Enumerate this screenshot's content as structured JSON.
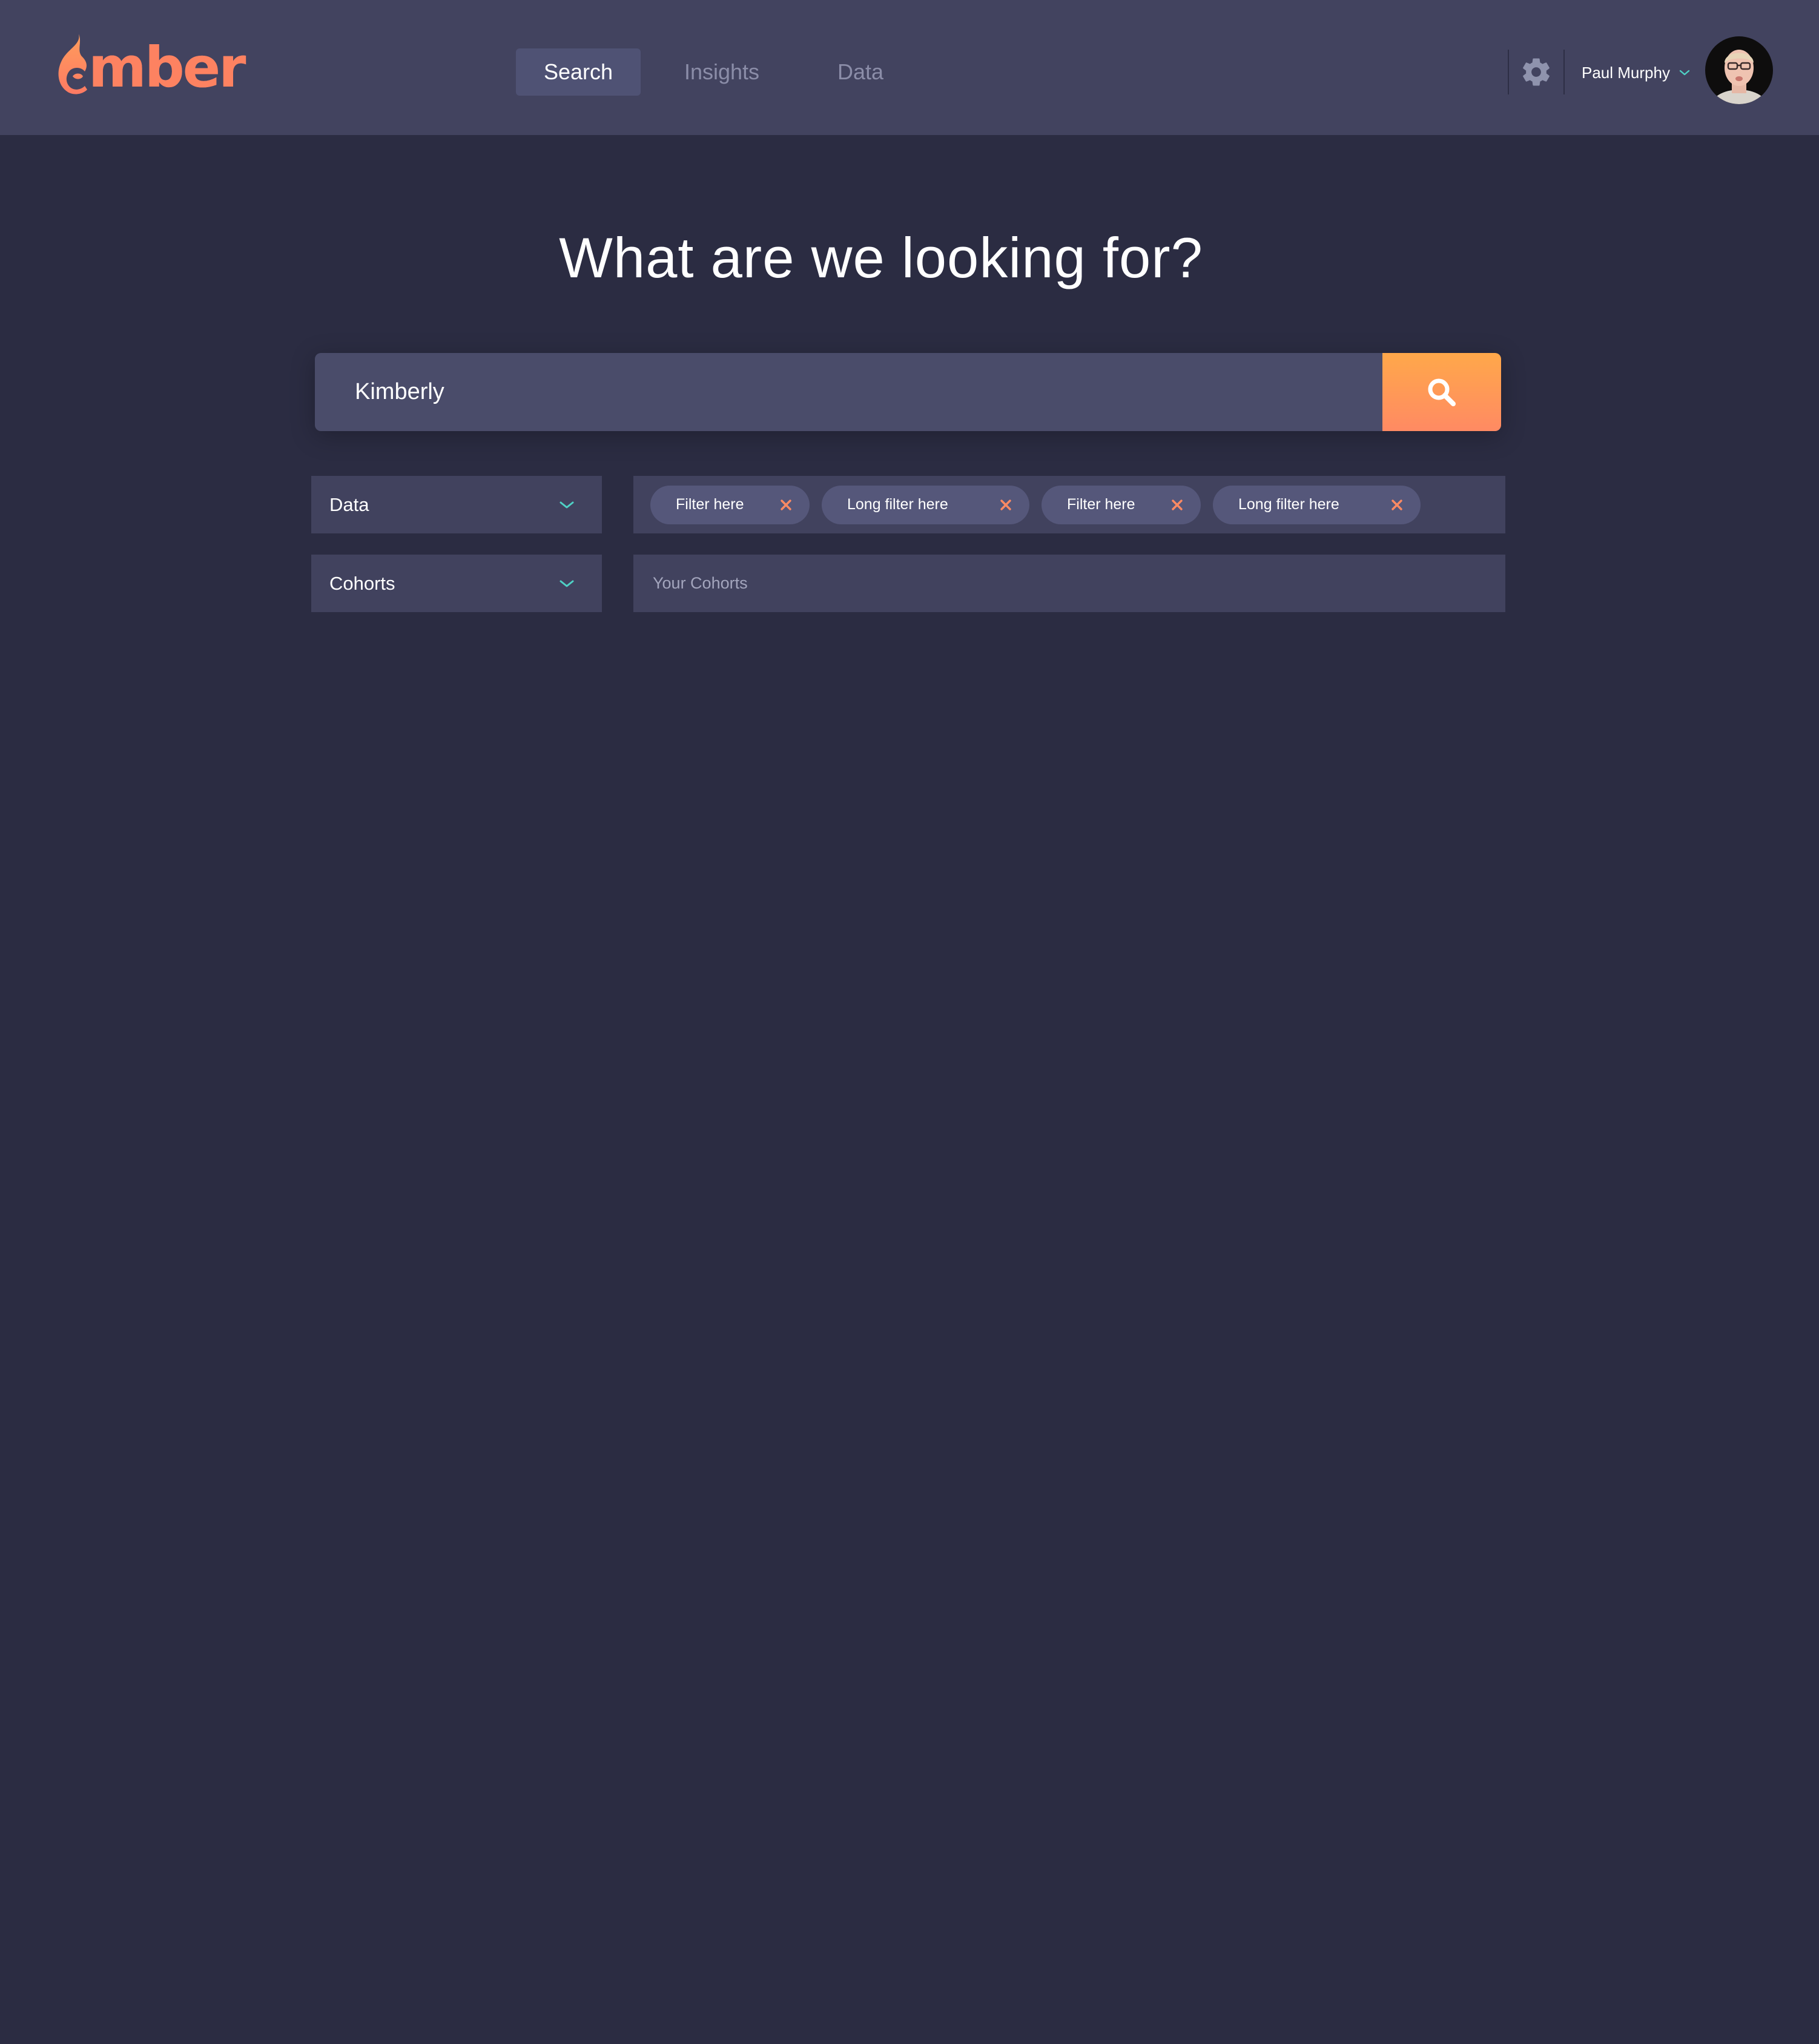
{
  "brand": {
    "name": "mber",
    "accent": "#fd8261",
    "icon": "flame-icon"
  },
  "nav": {
    "tabs": [
      {
        "label": "Search",
        "active": true
      },
      {
        "label": "Insights",
        "active": false
      },
      {
        "label": "Data",
        "active": false
      }
    ]
  },
  "header": {
    "settings_icon": "gear-icon",
    "user_name": "Paul Murphy",
    "user_menu_icon": "chevron-down-icon",
    "avatar_icon": "avatar"
  },
  "main": {
    "headline": "What are we looking for?",
    "search": {
      "value": "Kimberly",
      "button_icon": "search-icon",
      "button_color": "#ff9a56"
    },
    "dropdowns": [
      {
        "label": "Data",
        "icon": "chevron-down-icon"
      },
      {
        "label": "Cohorts",
        "icon": "chevron-down-icon"
      }
    ],
    "filters": [
      {
        "label": "Filter here"
      },
      {
        "label": "Long filter here"
      },
      {
        "label": "Filter here"
      },
      {
        "label": "Long filter here"
      }
    ],
    "cohorts_placeholder": "Your Cohorts"
  },
  "colors": {
    "background": "#2b2c42",
    "topbar": "#42435f",
    "panel": "#41425e",
    "chip": "#55577a",
    "chevron": "#4fd1c5",
    "close_x": "#ff8a63"
  }
}
